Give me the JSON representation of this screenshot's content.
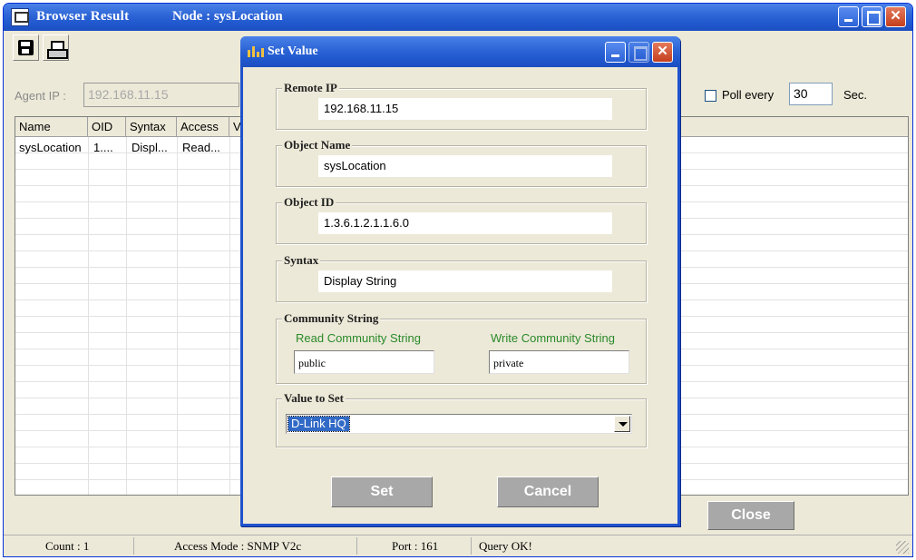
{
  "main_window": {
    "title": "Browser Result",
    "node_label": "Node : sysLocation",
    "agent_ip_label": "Agent IP :",
    "agent_ip_value": "192.168.11.15",
    "poll_label": "Poll every",
    "poll_value": "30",
    "poll_unit": "Sec.",
    "poll_checked": false,
    "close_label": "Close",
    "table": {
      "columns": [
        "Name",
        "OID",
        "Syntax",
        "Access",
        "V"
      ],
      "rows": [
        [
          "sysLocation",
          "1....",
          "Displ...",
          "Read...",
          ""
        ]
      ]
    },
    "status": {
      "count": "Count : 1",
      "access_mode": "Access Mode : SNMP V2c",
      "port": "Port : 161",
      "query": "Query OK!"
    }
  },
  "dialog": {
    "title": "Set Value",
    "remote_ip": {
      "label": "Remote IP",
      "value": "192.168.11.15"
    },
    "object_name": {
      "label": "Object Name",
      "value": "sysLocation"
    },
    "object_id": {
      "label": "Object ID",
      "value": "1.3.6.1.2.1.1.6.0"
    },
    "syntax": {
      "label": "Syntax",
      "value": "Display String"
    },
    "community": {
      "label": "Community String",
      "read_label": "Read Community String",
      "read_value": "public",
      "write_label": "Write Community String",
      "write_value": "private"
    },
    "value_to_set": {
      "label": "Value to Set",
      "value": "D-Link HQ"
    },
    "set_label": "Set",
    "cancel_label": "Cancel"
  },
  "colors": {
    "titlebar": "#2159cf",
    "close_button": "#c43f1d",
    "window_bg": "#ece9d8",
    "green_label": "#2a8a2a",
    "disabled_button": "#a8a8a8"
  }
}
